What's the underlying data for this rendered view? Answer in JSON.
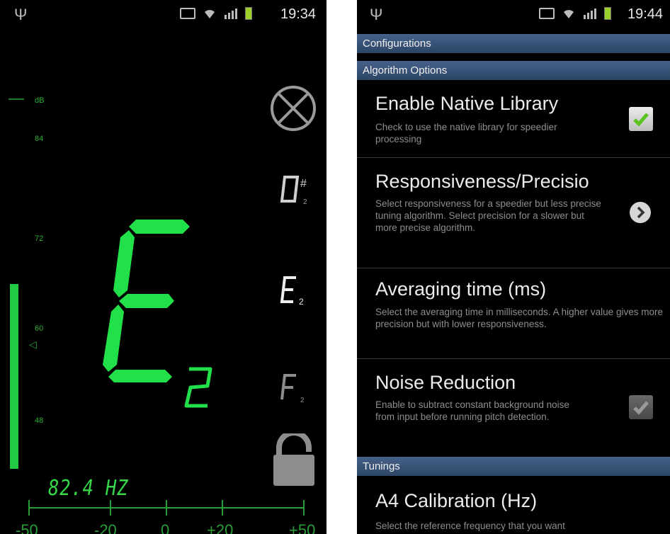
{
  "left_screen": {
    "status_bar": {
      "time": "19:34"
    },
    "db_scale": {
      "unit": "dB",
      "labels": [
        "84",
        "72",
        "60",
        "48"
      ]
    },
    "level": 0.26,
    "detected_note": {
      "letter": "E",
      "octave": "2"
    },
    "neighbor_notes": [
      {
        "letter": "D",
        "accidental": "#",
        "octave": "2"
      },
      {
        "letter": "E",
        "accidental": "",
        "octave": "2"
      },
      {
        "letter": "F",
        "accidental": "",
        "octave": "2"
      }
    ],
    "frequency": "82.4 HZ",
    "cents_scale": [
      "-50",
      "-20",
      "0",
      "+20",
      "+50"
    ],
    "icons": {
      "mute": "mute-icon",
      "lock": "unlocked-padlock-icon"
    },
    "colors": {
      "accent": "#22e04a",
      "dim": "#2a9d3a",
      "background": "#000000"
    }
  },
  "right_screen": {
    "status_bar": {
      "time": "19:44"
    },
    "screen_title": "Configurations",
    "categories": {
      "algorithm": "Algorithm Options",
      "tunings": "Tunings"
    },
    "preferences": {
      "native": {
        "title": "Enable Native Library",
        "summary": "Check to use the native library for speedier processing",
        "checked": true
      },
      "responsiveness": {
        "title": "Responsiveness/Precisio",
        "summary": "Select responsiveness for a speedier but less precise tuning algorithm. Select precision for a slower but more precise algorithm."
      },
      "averaging": {
        "title": "Averaging time (ms)",
        "summary": "Select the averaging time in milliseconds. A higher value gives more precision but with lower responsiveness."
      },
      "noise": {
        "title": "Noise Reduction",
        "summary": "Enable to subtract constant background noise from input before running pitch detection.",
        "checked": true
      },
      "calibration": {
        "title": "A4 Calibration (Hz)",
        "summary": "Select the reference frequency that you want"
      }
    },
    "colors": {
      "category_bar": "#3a5478",
      "checkbox_green": "#5cc21e"
    }
  }
}
